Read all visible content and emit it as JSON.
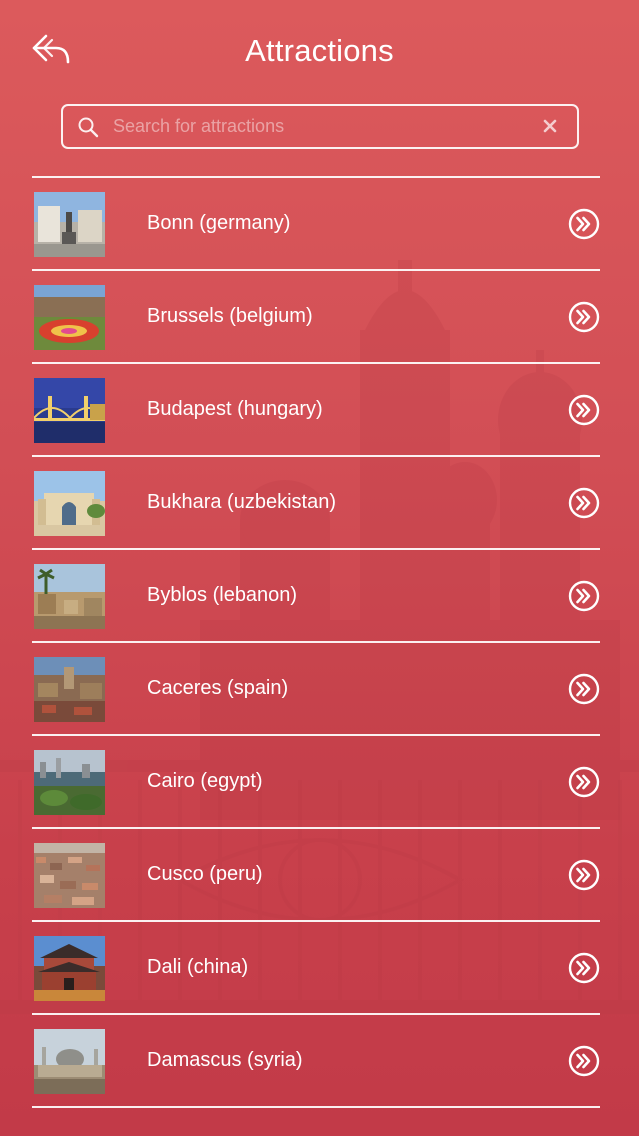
{
  "header": {
    "title": "Attractions",
    "back_icon": "back-arrow-icon"
  },
  "search": {
    "placeholder": "Search for attractions",
    "value": "",
    "search_icon": "search-icon",
    "clear_icon": "close-icon"
  },
  "colors": {
    "background_top": "#dc5a5c",
    "background_bottom": "#c23a48",
    "foreground": "#ffffff"
  },
  "items": [
    {
      "label": "Bonn (germany)",
      "icon": "chevron-double-right-icon"
    },
    {
      "label": "Brussels (belgium)",
      "icon": "chevron-double-right-icon"
    },
    {
      "label": "Budapest (hungary)",
      "icon": "chevron-double-right-icon"
    },
    {
      "label": "Bukhara (uzbekistan)",
      "icon": "chevron-double-right-icon"
    },
    {
      "label": "Byblos (lebanon)",
      "icon": "chevron-double-right-icon"
    },
    {
      "label": "Caceres (spain)",
      "icon": "chevron-double-right-icon"
    },
    {
      "label": "Cairo (egypt)",
      "icon": "chevron-double-right-icon"
    },
    {
      "label": "Cusco (peru)",
      "icon": "chevron-double-right-icon"
    },
    {
      "label": "Dali (china)",
      "icon": "chevron-double-right-icon"
    },
    {
      "label": "Damascus (syria)",
      "icon": "chevron-double-right-icon"
    }
  ]
}
